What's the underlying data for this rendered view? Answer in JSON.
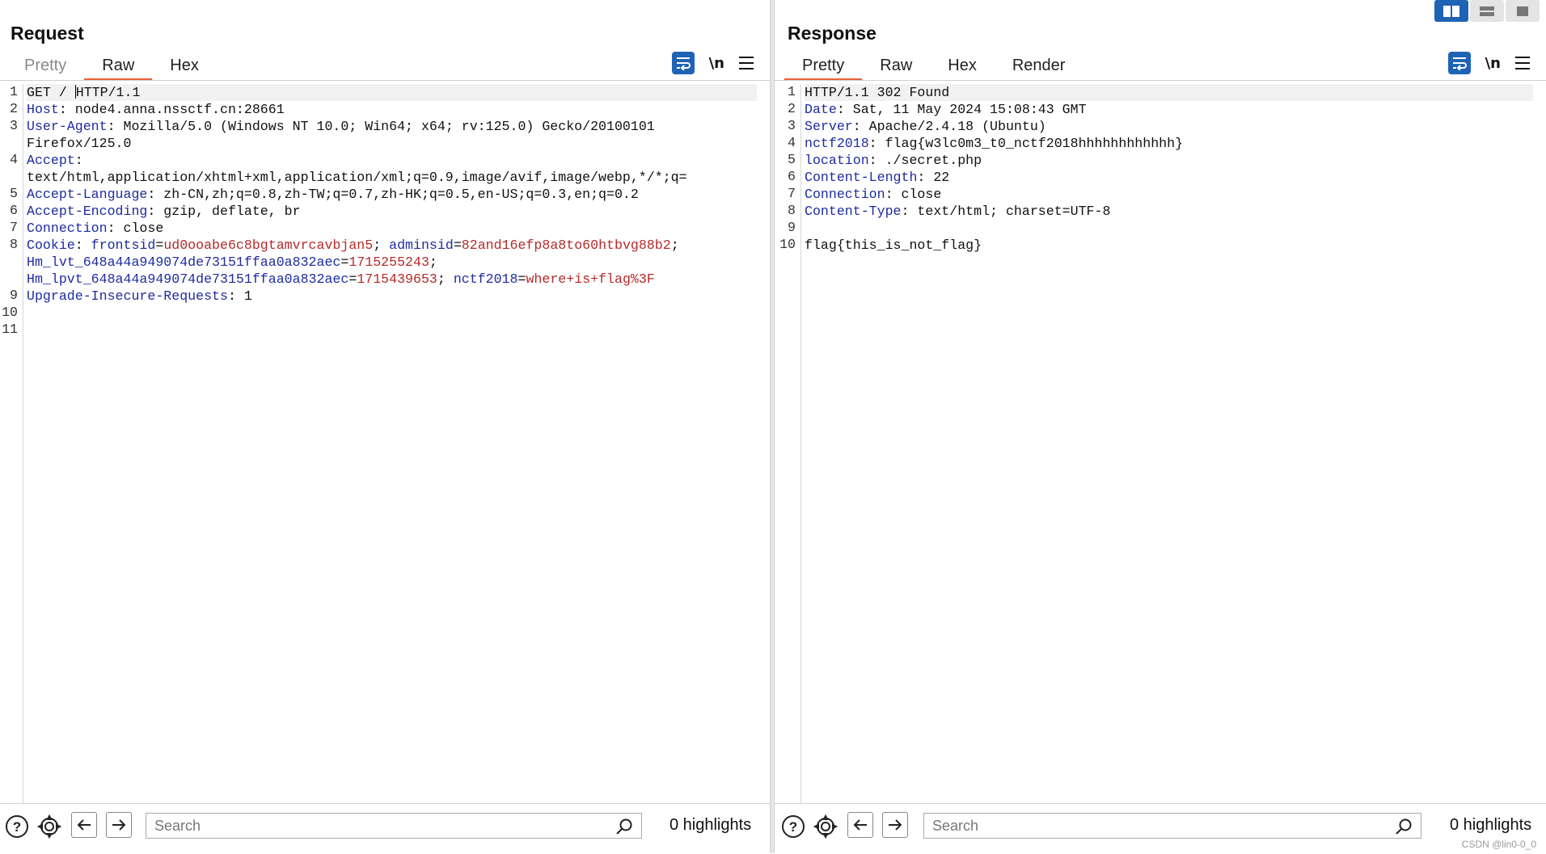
{
  "layout_controls": {
    "icons": [
      "split-columns-icon",
      "split-rows-icon",
      "single-tab-icon"
    ]
  },
  "request": {
    "title": "Request",
    "tabs": [
      {
        "label": "Pretty"
      },
      {
        "label": "Raw"
      },
      {
        "label": "Hex"
      }
    ],
    "active_tab": "Raw",
    "tools": {
      "newline_label": "\\n"
    },
    "lines": {
      "l1": {
        "num": "1",
        "text_a": "GET / ",
        "text_b": "HTTP/1.1"
      },
      "l2": {
        "num": "2",
        "name": "Host",
        "value": " node4.anna.nssctf.cn:28661"
      },
      "l3": {
        "num": "3",
        "name": "User-Agent",
        "value": " Mozilla/5.0 (Windows NT 10.0; Win64; x64; rv:125.0) Gecko/20100101",
        "wrap": "Firefox/125.0"
      },
      "l4": {
        "num": "4",
        "name": "Accept",
        "value": "",
        "wrap": "text/html,application/xhtml+xml,application/xml;q=0.9,image/avif,image/webp,*/*;q="
      },
      "l5": {
        "num": "5",
        "name": "Accept-Language",
        "value": " zh-CN,zh;q=0.8,zh-TW;q=0.7,zh-HK;q=0.5,en-US;q=0.3,en;q=0.2"
      },
      "l6": {
        "num": "6",
        "name": "Accept-Encoding",
        "value": " gzip, deflate, br"
      },
      "l7": {
        "num": "7",
        "name": "Connection",
        "value": " close"
      },
      "l8": {
        "num": "8",
        "name": "Cookie",
        "c1_name": "frontsid",
        "c1_val": "ud0ooabe6c8bgtamvrcavbjan5",
        "c2_name": "adminsid",
        "c2_val": "82and16efp8a8to60htbvg88b2",
        "c3_name": "Hm_lvt_648a44a949074de73151ffaa0a832aec",
        "c3_val": "1715255243",
        "c4_name": "Hm_lpvt_648a44a949074de73151ffaa0a832aec",
        "c4_val": "1715439653",
        "c5_name": "nctf2018",
        "c5_val": "where+is+flag%3F"
      },
      "l9": {
        "num": "9",
        "name": "Upgrade-Insecure-Requests",
        "value": " 1"
      },
      "l10": {
        "num": "10"
      },
      "l11": {
        "num": "11"
      }
    },
    "search": {
      "placeholder": "Search",
      "highlights": "0 highlights"
    }
  },
  "response": {
    "title": "Response",
    "tabs": [
      {
        "label": "Pretty"
      },
      {
        "label": "Raw"
      },
      {
        "label": "Hex"
      },
      {
        "label": "Render"
      }
    ],
    "active_tab": "Pretty",
    "tools": {
      "newline_label": "\\n"
    },
    "lines": {
      "l1": {
        "num": "1",
        "text": "HTTP/1.1 302 Found"
      },
      "l2": {
        "num": "2",
        "name": "Date",
        "value": " Sat, 11 May 2024 15:08:43 GMT"
      },
      "l3": {
        "num": "3",
        "name": "Server",
        "value": " Apache/2.4.18 (Ubuntu)"
      },
      "l4": {
        "num": "4",
        "name": "nctf2018",
        "value": " flag{w3lc0m3_t0_nctf2018hhhhhhhhhhhh}"
      },
      "l5": {
        "num": "5",
        "name": "location",
        "value": " ./secret.php"
      },
      "l6": {
        "num": "6",
        "name": "Content-Length",
        "value": " 22"
      },
      "l7": {
        "num": "7",
        "name": "Connection",
        "value": " close"
      },
      "l8": {
        "num": "8",
        "name": "Content-Type",
        "value": " text/html; charset=UTF-8"
      },
      "l9": {
        "num": "9"
      },
      "l10": {
        "num": "10",
        "text": "flag{this_is_not_flag}"
      }
    },
    "search": {
      "placeholder": "Search",
      "highlights": "0 highlights"
    }
  },
  "watermark": "CSDN @lin0-0_0",
  "colors": {
    "accent": "#e8623a",
    "primary_blue": "#1f63b5",
    "header_name": "#1d2ca0",
    "cookie_value": "#b52a2a"
  }
}
